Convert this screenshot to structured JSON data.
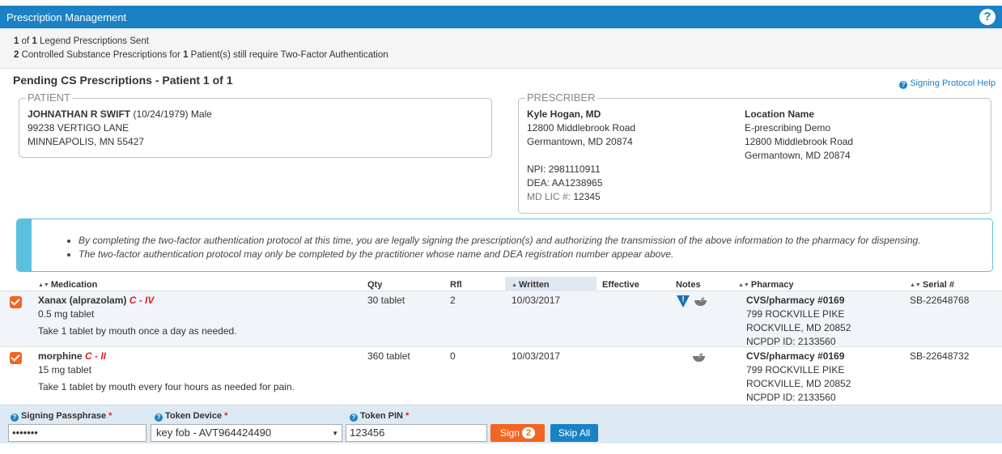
{
  "header": {
    "title": "Prescription Management",
    "help_glyph": "?"
  },
  "summary": {
    "line1_count": "1",
    "line1_of": "of",
    "line1_total": "1",
    "line1_text": "Legend Prescriptions Sent",
    "line2_count": "2",
    "line2_text_a": "Controlled Substance Prescriptions for",
    "line2_patients": "1",
    "line2_text_b": "Patient(s) still require Two-Factor Authentication"
  },
  "section": {
    "heading": "Pending CS Prescriptions - Patient 1 of 1",
    "protocol_help_link": "Signing Protocol Help"
  },
  "patient": {
    "legend": "PATIENT",
    "name": "JOHNATHAN R SWIFT",
    "dob_gender": "(10/24/1979) Male",
    "address1": "99238 VERTIGO LANE",
    "address2": "MINNEAPOLIS, MN 55427"
  },
  "prescriber": {
    "legend": "PRESCRIBER",
    "name": "Kyle Hogan, MD",
    "address1": "12800 Middlebrook Road",
    "address2": "Germantown, MD 20874",
    "npi": "NPI: 2981110911",
    "dea": "DEA: AA1238965",
    "md_lic_label": "MD LIC #:",
    "md_lic_value": "12345",
    "location_heading": "Location Name",
    "location_name": "E-prescribing Demo",
    "location_address1": "12800 Middlebrook Road",
    "location_address2": "Germantown, MD 20874"
  },
  "notice": {
    "items": [
      "By completing the two-factor authentication protocol at this time, you are legally signing the prescription(s) and authorizing the transmission of the above information to the pharmacy for dispensing.",
      "The two-factor authentication protocol may only be completed by the practitioner whose name and DEA registration number appear above."
    ]
  },
  "table": {
    "columns": {
      "medication": "Medication",
      "qty": "Qty",
      "rfl": "Rfl",
      "written": "Written",
      "effective": "Effective",
      "notes": "Notes",
      "pharmacy": "Pharmacy",
      "serial": "Serial #"
    },
    "rows": [
      {
        "checked": true,
        "drug": "Xanax (alprazolam)",
        "schedule": "C - IV",
        "strength": "0.5 mg tablet",
        "sig": "Take 1 tablet by mouth once a day as needed.",
        "qty": "30 tablet",
        "rfl": "2",
        "written": "10/03/2017",
        "effective": "",
        "notes_icons": [
          "warning-icon",
          "mortar-pestle-icon"
        ],
        "pharmacy_name": "CVS/pharmacy #0169",
        "pharmacy_address1": "799 ROCKVILLE PIKE",
        "pharmacy_address2": "ROCKVILLE, MD 20852",
        "pharmacy_ncpdp": "NCPDP ID: 2133560",
        "serial": "SB-22648768"
      },
      {
        "checked": true,
        "drug": "morphine",
        "schedule": "C - II",
        "strength": "15 mg tablet",
        "sig": "Take 1 tablet by mouth every four hours as needed for pain.",
        "qty": "360 tablet",
        "rfl": "0",
        "written": "10/03/2017",
        "effective": "",
        "notes_icons": [
          "mortar-pestle-icon"
        ],
        "pharmacy_name": "CVS/pharmacy #0169",
        "pharmacy_address1": "799 ROCKVILLE PIKE",
        "pharmacy_address2": "ROCKVILLE, MD 20852",
        "pharmacy_ncpdp": "NCPDP ID: 2133560",
        "serial": "SB-22648732"
      }
    ]
  },
  "signing": {
    "passphrase_label": "Signing Passphrase",
    "passphrase_value": "•••••••",
    "token_device_label": "Token Device",
    "token_device_value": "key fob - AVT964424490",
    "token_pin_label": "Token PIN",
    "token_pin_value": "123456",
    "required_mark": "*",
    "sign_label": "Sign",
    "sign_count": "2",
    "skip_label": "Skip All"
  },
  "colors": {
    "header_blue": "#1a82c4",
    "accent_orange": "#f26522",
    "schedule_red": "#e02020",
    "notice_blue": "#5bc0de"
  }
}
